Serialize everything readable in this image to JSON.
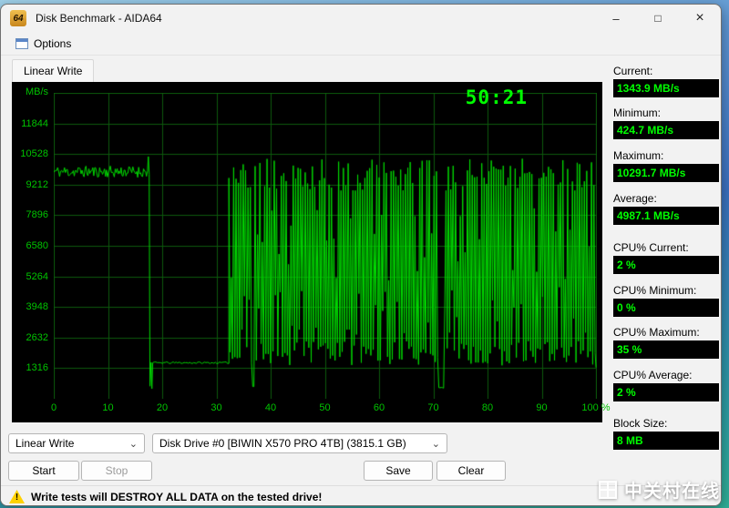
{
  "window": {
    "title": "Disk Benchmark - AIDA64",
    "app_icon_text": "64",
    "caption": {
      "minimize": "–",
      "maximize": "□",
      "close": "×"
    }
  },
  "menu": {
    "options_label": "Options"
  },
  "tab_label": "Linear Write",
  "chart_data": {
    "type": "line",
    "title": "Linear Write disk benchmark",
    "ylabel": "MB/s",
    "xlabel": "",
    "timer": "50:21",
    "y_ticks": [
      "11844",
      "10528",
      "9212",
      "7896",
      "6580",
      "5264",
      "3948",
      "2632",
      "1316"
    ],
    "x_ticks": [
      "0",
      "10",
      "20",
      "30",
      "40",
      "50",
      "60",
      "70",
      "80",
      "90",
      "100 %"
    ],
    "ymax": 13160,
    "y_step": 1316,
    "xmax": 100,
    "seed": 11,
    "grid_on": true,
    "bg_color": "#000000",
    "grid_color": "#0c5a0c",
    "line_color": "#00dc00",
    "tick_color": "#00c400",
    "timer_color": "#00ff00",
    "segments": [
      {
        "kind": "noisy",
        "from": 0,
        "to": 17.35,
        "step": 0.18,
        "base": 9770,
        "amp": 250
      },
      {
        "kind": "points",
        "pts": [
          [
            17.45,
            10420
          ],
          [
            17.6,
            9650
          ],
          [
            17.75,
            540
          ],
          [
            17.95,
            1560
          ],
          [
            18.1,
            432
          ],
          [
            18.25,
            1550
          ]
        ]
      },
      {
        "kind": "noisy",
        "from": 18.3,
        "to": 32.3,
        "step": 0.25,
        "base": 1548,
        "amp": 38
      },
      {
        "kind": "spiky",
        "from": 32.3,
        "to": 99.9,
        "step": 0.22,
        "high": [
          8950,
          10330
        ],
        "mid": [
          5000,
          8300
        ],
        "mid_chance": 0.15,
        "low": [
          1430,
          2500
        ],
        "low_mid": [
          2700,
          4800
        ],
        "low_mid_chance": 0.18,
        "dips": [
          36.7,
          71.2,
          71.5,
          71.8
        ],
        "dip_val": 440
      },
      {
        "kind": "points",
        "pts": [
          [
            100,
            1344
          ]
        ]
      }
    ]
  },
  "stats": {
    "items": [
      {
        "label": "Current:",
        "value": "1343.9 MB/s"
      },
      {
        "label": "Minimum:",
        "value": "424.7 MB/s"
      },
      {
        "label": "Maximum:",
        "value": "10291.7 MB/s"
      },
      {
        "label": "Average:",
        "value": "4987.1 MB/s"
      },
      {
        "label": "CPU% Current:",
        "value": "2 %"
      },
      {
        "label": "CPU% Minimum:",
        "value": "0 %"
      },
      {
        "label": "CPU% Maximum:",
        "value": "35 %"
      },
      {
        "label": "CPU% Average:",
        "value": "2 %"
      },
      {
        "label": "Block Size:",
        "value": "8 MB"
      }
    ]
  },
  "controls": {
    "test_type": "Linear Write",
    "drive": "Disk Drive #0  [BIWIN X570 PRO 4TB]  (3815.1 GB)",
    "chevron": "⌄",
    "start": "Start",
    "stop": "Stop",
    "save": "Save",
    "clear": "Clear"
  },
  "status": {
    "warning_mark": "!",
    "warning": "Write tests will DESTROY ALL DATA on the tested drive!"
  },
  "watermark": {
    "text": "中关村在线"
  }
}
